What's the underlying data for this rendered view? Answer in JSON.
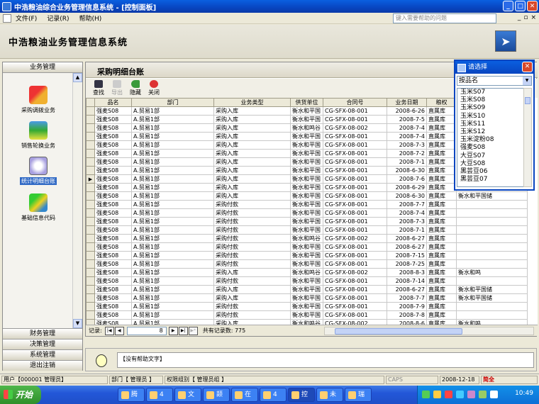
{
  "window": {
    "title": "中浩粮油综合业务管理信息系统 - [控制面板]"
  },
  "menu": {
    "items": [
      "文件(F)",
      "记录(R)",
      "帮助(H)"
    ],
    "help_placeholder": "键入需要帮助的问题"
  },
  "app": {
    "title": "中浩粮油业务管理信息系统"
  },
  "sidebar": {
    "header": "业务管理",
    "items": [
      "采购调拨业务",
      "销售轮换业务",
      "统计明细台账",
      "基础信息代码"
    ],
    "active": "统计明细台账",
    "bottom": [
      "财务管理",
      "决策管理",
      "系统管理",
      "退出注销"
    ]
  },
  "panel": {
    "title": "采购明细台账"
  },
  "toolbar": {
    "find": "查找",
    "export": "导出",
    "hide": "隐藏",
    "close": "关闭"
  },
  "grid": {
    "columns": [
      "品名",
      "部门",
      "业务类型",
      "供货单位",
      "合同号",
      "业务日期",
      "粮权"
    ],
    "rows": [
      [
        "强麦S08",
        "A.贸易1部",
        "采购入库",
        "衡水和平国",
        "CG-SFX-08-001",
        "2008-6-26",
        "直属库",
        ""
      ],
      [
        "强麦S08",
        "A.贸易1部",
        "采购入库",
        "衡水和平国",
        "CG-SFX-08-001",
        "2008-7-5",
        "直属库",
        ""
      ],
      [
        "强麦S08",
        "A.贸易1部",
        "采购入库",
        "衡水和鸣谷",
        "CG-SFX-08-002",
        "2008-7-4",
        "直属库",
        ""
      ],
      [
        "强麦S08",
        "A.贸易1部",
        "采购入库",
        "衡水和平国",
        "CG-SFX-08-001",
        "2008-7-4",
        "直属库",
        ""
      ],
      [
        "强麦S08",
        "A.贸易1部",
        "采购入库",
        "衡水和平国",
        "CG-SFX-08-001",
        "2008-7-3",
        "直属库",
        ""
      ],
      [
        "强麦S08",
        "A.贸易1部",
        "采购入库",
        "衡水和平国",
        "CG-SFX-08-001",
        "2008-7-2",
        "直属库",
        ""
      ],
      [
        "强麦S08",
        "A.贸易1部",
        "采购入库",
        "衡水和平国",
        "CG-SFX-08-001",
        "2008-7-1",
        "直属库",
        ""
      ],
      [
        "强麦S08",
        "A.贸易1部",
        "采购入库",
        "衡水和平国",
        "CG-SFX-08-001",
        "2008-6-30",
        "直属库",
        ""
      ],
      [
        "强麦S08",
        "A.贸易1部",
        "采购入库",
        "衡水和平国",
        "CG-SFX-08-001",
        "2008-7-6",
        "直属库",
        ""
      ],
      [
        "强麦S08",
        "A.贸易1部",
        "采购入库",
        "衡水和平国",
        "CG-SFX-08-001",
        "2008-6-29",
        "直属库",
        ""
      ],
      [
        "强麦S08",
        "A.贸易1部",
        "采购入库",
        "衡水和平国",
        "CG-SFX-08-001",
        "2008-6-30",
        "直属库",
        "衡水和平国储"
      ],
      [
        "强麦S08",
        "A.贸易1部",
        "采购付款",
        "衡水和平国",
        "CG-SFX-08-001",
        "2008-7-7",
        "直属库",
        ""
      ],
      [
        "强麦S08",
        "A.贸易1部",
        "采购付款",
        "衡水和平国",
        "CG-SFX-08-001",
        "2008-7-4",
        "直属库",
        ""
      ],
      [
        "强麦S08",
        "A.贸易1部",
        "采购付款",
        "衡水和平国",
        "CG-SFX-08-001",
        "2008-7-3",
        "直属库",
        ""
      ],
      [
        "强麦S08",
        "A.贸易1部",
        "采购付款",
        "衡水和平国",
        "CG-SFX-08-001",
        "2008-7-1",
        "直属库",
        ""
      ],
      [
        "强麦S08",
        "A.贸易1部",
        "采购付款",
        "衡水和鸣谷",
        "CG-SFX-08-002",
        "2008-6-27",
        "直属库",
        ""
      ],
      [
        "强麦S08",
        "A.贸易1部",
        "采购付款",
        "衡水和平国",
        "CG-SFX-08-001",
        "2008-6-27",
        "直属库",
        ""
      ],
      [
        "强麦S08",
        "A.贸易1部",
        "采购付款",
        "衡水和平国",
        "CG-SFX-08-001",
        "2008-7-15",
        "直属库",
        ""
      ],
      [
        "强麦S08",
        "A.贸易1部",
        "采购付款",
        "衡水和平国",
        "CG-SFX-08-001",
        "2008-7-25",
        "直属库",
        ""
      ],
      [
        "强麦S08",
        "A.贸易1部",
        "采购入库",
        "衡水和鸣谷",
        "CG-SFX-08-002",
        "2008-8-3",
        "直属库",
        "衡水和鸣"
      ],
      [
        "强麦S08",
        "A.贸易1部",
        "采购付款",
        "衡水和平国",
        "CG-SFX-08-001",
        "2008-7-14",
        "直属库",
        ""
      ],
      [
        "强麦S08",
        "A.贸易1部",
        "采购入库",
        "衡水和平国",
        "CG-SFX-08-001",
        "2008-6-27",
        "直属库",
        "衡水和平国储"
      ],
      [
        "强麦S08",
        "A.贸易1部",
        "采购入库",
        "衡水和平国",
        "CG-SFX-08-001",
        "2008-7-7",
        "直属库",
        "衡水和平国储"
      ],
      [
        "强麦S08",
        "A.贸易1部",
        "采购付款",
        "衡水和平国",
        "CG-SFX-08-001",
        "2008-7-9",
        "直属库",
        ""
      ],
      [
        "强麦S08",
        "A.贸易1部",
        "采购付款",
        "衡水和平国",
        "CG-SFX-08-001",
        "2008-7-8",
        "直属库",
        ""
      ],
      [
        "强麦S08",
        "A.贸易1部",
        "采购入库",
        "衡水和鸣谷",
        "CG-SFX-08-002",
        "2008-8-6",
        "直属库",
        "衡水和鸣"
      ]
    ],
    "current_row": 8
  },
  "navigator": {
    "label": "记录:",
    "position": "8",
    "total": "共有记录数: 775"
  },
  "help": {
    "text": "【没有帮助文字】"
  },
  "status": {
    "user": "用户【000001 管理员】",
    "dept": "部门【 管理员 】",
    "group": "权限组别【 管理员组 】",
    "caps": "CAPS",
    "date": "2008-12-18",
    "ime": "简全"
  },
  "taskbar": {
    "start": "开始",
    "tasks": [
      "腾",
      "4",
      "文",
      "颉",
      "在",
      "4",
      "控",
      "未",
      "瑞"
    ],
    "clock": "10:49"
  },
  "popup": {
    "title": "请选择",
    "select": "按品名",
    "items": [
      "玉米S07",
      "玉米S08",
      "玉米S09",
      "玉米S10",
      "玉米S11",
      "玉米S12",
      "玉米淀粉08",
      "强麦S08",
      "大豆S07",
      "大豆S08",
      "黑芸豆06",
      "黑芸豆07"
    ]
  }
}
